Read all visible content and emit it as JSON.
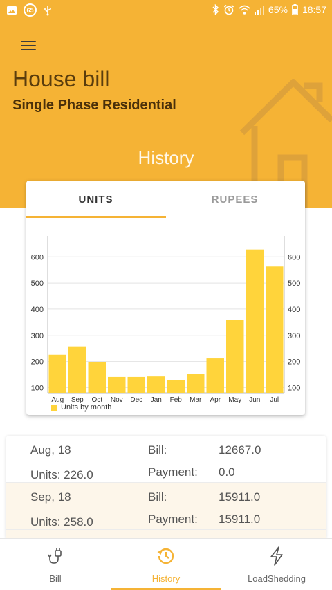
{
  "status_bar": {
    "badge": "65",
    "battery": "65%",
    "time": "18:57"
  },
  "header": {
    "title": "House bill",
    "subtitle": "Single Phase Residential",
    "heading": "History"
  },
  "tabs": [
    {
      "label": "UNITS",
      "active": true
    },
    {
      "label": "RUPEES",
      "active": false
    }
  ],
  "colors": {
    "accent": "#f5b335",
    "bar": "#ffd43b"
  },
  "chart_data": {
    "type": "bar",
    "categories": [
      "Aug",
      "Sep",
      "Oct",
      "Nov",
      "Dec",
      "Jan",
      "Feb",
      "Mar",
      "Apr",
      "May",
      "Jun",
      "Jul"
    ],
    "series": [
      {
        "name": "Units by month",
        "values": [
          226,
          258,
          198,
          141,
          141,
          143,
          130,
          152,
          212,
          358,
          628,
          563
        ]
      }
    ],
    "yticks": [
      100,
      200,
      300,
      400,
      500,
      600
    ],
    "ylim": [
      80,
      680
    ],
    "grid": true,
    "legend": "bottom-left"
  },
  "records": [
    {
      "month": "Aug, 18",
      "units": "Units: 226.0",
      "bill_label": "Bill:",
      "bill": "12667.0",
      "payment_label": "Payment:",
      "payment": "0.0"
    },
    {
      "month": "Sep, 18",
      "units": "Units: 258.0",
      "bill_label": "Bill:",
      "bill": "15911.0",
      "payment_label": "Payment:",
      "payment": "15911.0"
    }
  ],
  "nav": [
    {
      "label": "Bill",
      "icon": "plug-icon"
    },
    {
      "label": "History",
      "icon": "history-icon"
    },
    {
      "label": "LoadShedding",
      "icon": "lightning-icon"
    }
  ]
}
